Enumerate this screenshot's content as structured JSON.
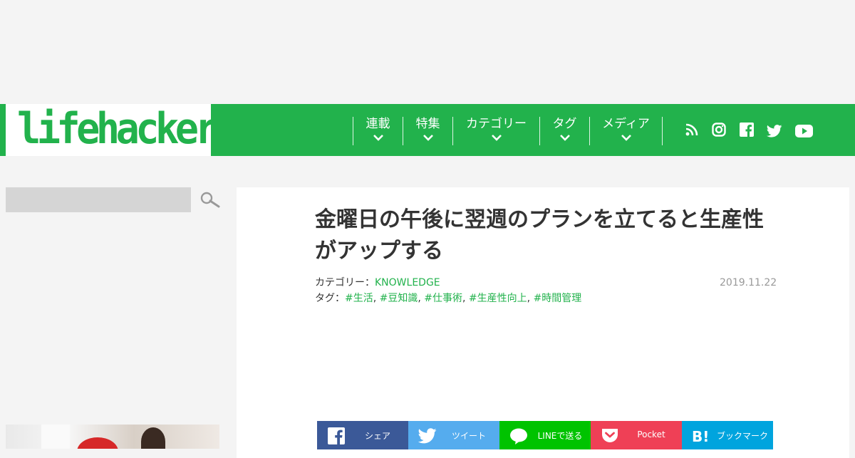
{
  "brand": {
    "logo_text": "lifehacker",
    "accent_color": "#22b24c"
  },
  "nav": {
    "items": [
      {
        "label": "連載"
      },
      {
        "label": "特集"
      },
      {
        "label": "カテゴリー"
      },
      {
        "label": "タグ"
      },
      {
        "label": "メディア"
      }
    ],
    "social_icons": [
      "rss-icon",
      "instagram-icon",
      "facebook-icon",
      "twitter-icon",
      "youtube-icon"
    ]
  },
  "search": {
    "placeholder": "",
    "value": ""
  },
  "article": {
    "title": "金曜日の午後に翌週のプランを立てると生産性がアップする",
    "category_label": "カテゴリー：",
    "category_value": "KNOWLEDGE",
    "tags_label": "タグ：",
    "tags": [
      "#生活",
      "#豆知識",
      "#仕事術",
      "#生産性向上",
      "#時間管理"
    ],
    "date": "2019.11.22"
  },
  "share": {
    "buttons": [
      {
        "label": "シェア",
        "icon": "facebook-icon",
        "color": "#3b5998"
      },
      {
        "label": "ツイート",
        "icon": "twitter-icon",
        "color": "#55acee"
      },
      {
        "label": "LINEで送る",
        "icon": "line-icon",
        "color": "#00c300"
      },
      {
        "label": "Pocket",
        "icon": "pocket-icon",
        "color": "#ef4056"
      },
      {
        "label": "ブックマーク",
        "icon": "hatena-bookmark-icon",
        "color": "#00a4de"
      }
    ]
  }
}
